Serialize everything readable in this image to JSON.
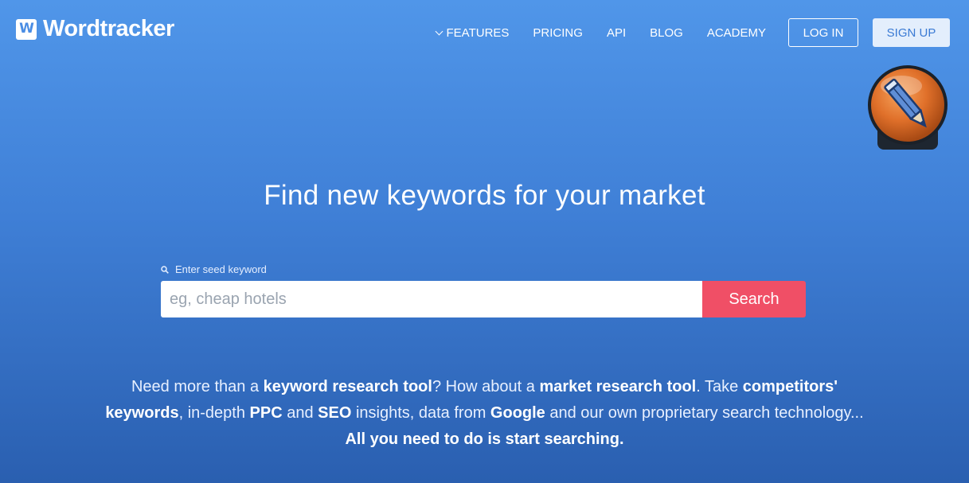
{
  "header": {
    "logo_mark": "W",
    "logo_text": "Wordtracker",
    "nav": {
      "features": "FEATURES",
      "pricing": "PRICING",
      "api": "API",
      "blog": "BLOG",
      "academy": "ACADEMY"
    },
    "login_label": "LOG IN",
    "signup_label": "SIGN UP"
  },
  "badge": {
    "icon": "pencil-icon",
    "color": "#e0702a"
  },
  "hero": {
    "headline": "Find new keywords for your market",
    "search": {
      "hint_label": "Enter seed keyword",
      "placeholder": "eg, cheap hotels",
      "value": "",
      "button_label": "Search"
    },
    "blurb": [
      {
        "text": "Need more than a ",
        "bold": false
      },
      {
        "text": "keyword research tool",
        "bold": true
      },
      {
        "text": "? How about a ",
        "bold": false
      },
      {
        "text": "market research tool",
        "bold": true
      },
      {
        "text": ". Take ",
        "bold": false
      },
      {
        "text": "competitors' keywords",
        "bold": true
      },
      {
        "text": ", in-depth ",
        "bold": false
      },
      {
        "text": "PPC",
        "bold": true
      },
      {
        "text": " and ",
        "bold": false
      },
      {
        "text": "SEO",
        "bold": true
      },
      {
        "text": " insights, data from ",
        "bold": false
      },
      {
        "text": "Google",
        "bold": true
      },
      {
        "text": " and our own proprietary search technology... ",
        "bold": false
      },
      {
        "text": "All you need to do is start searching.",
        "bold": true
      }
    ]
  },
  "colors": {
    "background_top": "#5096e9",
    "background_bottom": "#2a5fb0",
    "search_button": "#f04f66",
    "signup_bg": "#e3eefc"
  }
}
